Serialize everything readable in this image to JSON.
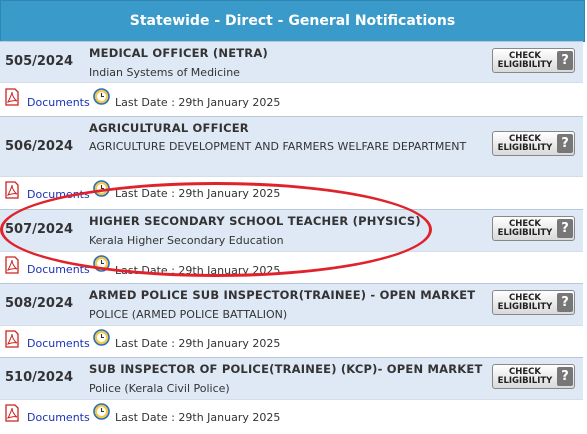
{
  "header": {
    "title": "Statewide - Direct - General Notifications"
  },
  "buttons": {
    "check_line1": "CHECK",
    "check_line2": "ELIGIBILITY",
    "help_mark": "?"
  },
  "documents_label": "Documents",
  "last_date_label": "Last Date : 29th January 2025",
  "notifications": [
    {
      "code": "505/2024",
      "title": "MEDICAL OFFICER (NETRA)",
      "department": "Indian Systems of Medicine"
    },
    {
      "code": "506/2024",
      "title": "AGRICULTURAL OFFICER",
      "department": "AGRICULTURE DEVELOPMENT AND FARMERS WELFARE DEPARTMENT"
    },
    {
      "code": "507/2024",
      "title": "HIGHER SECONDARY SCHOOL TEACHER (PHYSICS)",
      "department": "Kerala Higher Secondary Education"
    },
    {
      "code": "508/2024",
      "title": "ARMED POLICE SUB INSPECTOR(TRAINEE) - OPEN MARKET",
      "department": "POLICE (ARMED POLICE BATTALION)"
    },
    {
      "code": "510/2024",
      "title": "SUB INSPECTOR OF POLICE(TRAINEE) (KCP)- OPEN MARKET",
      "department": "Police (Kerala Civil Police)"
    }
  ],
  "highlight_color": "#e0222a"
}
